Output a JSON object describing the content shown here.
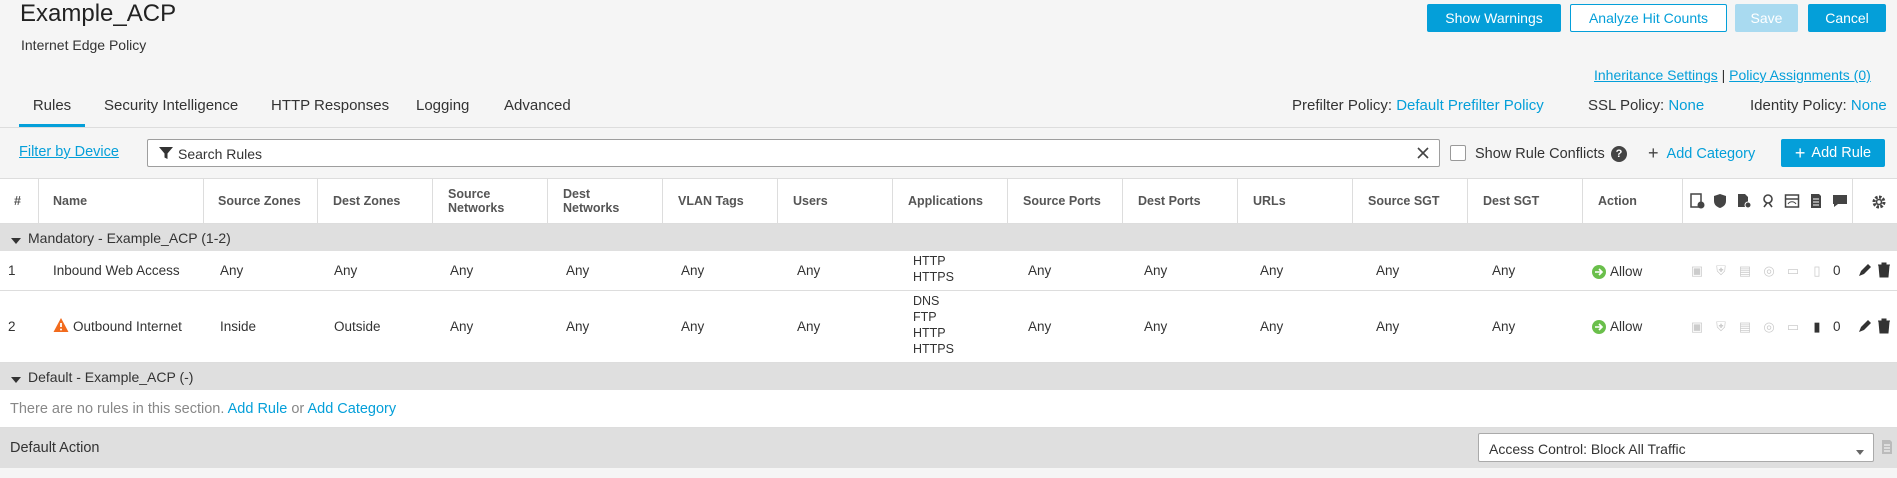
{
  "header": {
    "title": "Example_ACP",
    "subtitle": "Internet Edge Policy",
    "show_warnings": "Show Warnings",
    "analyze_hit_counts": "Analyze Hit Counts",
    "save": "Save",
    "cancel": "Cancel",
    "inheritance_settings": "Inheritance Settings",
    "separator": "|",
    "policy_assignments": "Policy Assignments (0)"
  },
  "tabs": [
    {
      "label": "Rules",
      "active": true
    },
    {
      "label": "Security Intelligence"
    },
    {
      "label": "HTTP Responses"
    },
    {
      "label": "Logging"
    },
    {
      "label": "Advanced"
    }
  ],
  "policies": {
    "prefilter_label": "Prefilter Policy:",
    "prefilter_value": "Default Prefilter Policy",
    "ssl_label": "SSL Policy:",
    "ssl_value": "None",
    "identity_label": "Identity Policy:",
    "identity_value": "None"
  },
  "toolbar": {
    "filter_by_device": "Filter by Device",
    "search_placeholder": "Search Rules",
    "show_rule_conflicts": "Show Rule Conflicts",
    "add_category": "Add Category",
    "add_rule": "Add Rule"
  },
  "columns": {
    "num": "#",
    "name": "Name",
    "source_zones": "Source Zones",
    "dest_zones": "Dest Zones",
    "source_networks_1": "Source",
    "source_networks_2": "Networks",
    "dest_networks_1": "Dest",
    "dest_networks_2": "Networks",
    "vlan_tags": "VLAN Tags",
    "users": "Users",
    "applications": "Applications",
    "source_ports": "Source Ports",
    "dest_ports": "Dest Ports",
    "urls": "URLs",
    "source_sgt": "Source SGT",
    "dest_sgt": "Dest SGT",
    "action": "Action"
  },
  "sections": {
    "mandatory": "Mandatory - Example_ACP (1-2)",
    "default": "Default - Example_ACP (-)",
    "empty_text": "There are no rules in this section.",
    "add_rule": "Add Rule",
    "or": "or",
    "add_category": "Add Category"
  },
  "rules": [
    {
      "num": "1",
      "name": "Inbound Web Access",
      "source_zones": "Any",
      "dest_zones": "Any",
      "source_networks": "Any",
      "dest_networks": "Any",
      "vlan_tags": "Any",
      "users": "Any",
      "apps": [
        "HTTP",
        "HTTPS"
      ],
      "source_ports": "Any",
      "dest_ports": "Any",
      "urls": "Any",
      "source_sgt": "Any",
      "dest_sgt": "Any",
      "action": "Allow",
      "count": "0"
    },
    {
      "num": "2",
      "name": "Outbound Internet",
      "source_zones": "Inside",
      "dest_zones": "Outside",
      "source_networks": "Any",
      "dest_networks": "Any",
      "vlan_tags": "Any",
      "users": "Any",
      "apps": [
        "DNS",
        "FTP",
        "HTTP",
        "HTTPS"
      ],
      "source_ports": "Any",
      "dest_ports": "Any",
      "urls": "Any",
      "source_sgt": "Any",
      "dest_sgt": "Any",
      "action": "Allow",
      "count": "0",
      "warning": true
    }
  ],
  "default_action": {
    "label": "Default Action",
    "value": "Access Control: Block All Traffic"
  },
  "colors": {
    "accent": "#049fd9",
    "allow": "#6abf4b",
    "warning": "#f26b1d"
  }
}
